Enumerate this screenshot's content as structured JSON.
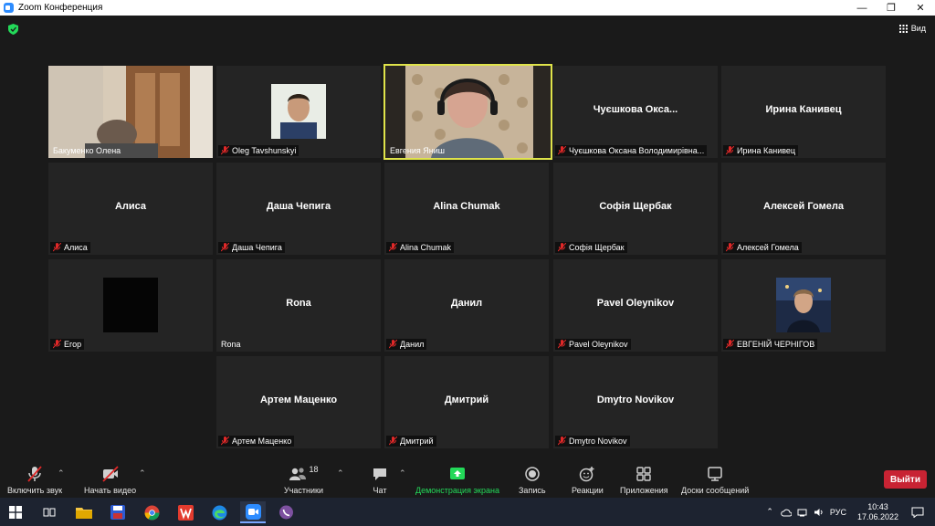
{
  "window": {
    "title": "Zoom Конференция",
    "minimize": "—",
    "maximize": "❐",
    "close": "✕"
  },
  "header": {
    "view_label": "Вид"
  },
  "tiles": [
    {
      "name": "Бакуменко Олена",
      "center": ""
    },
    {
      "name": "Oleg Tavshunskyi",
      "center": ""
    },
    {
      "name": "Евгения Яниш",
      "center": ""
    },
    {
      "name": "Чуєшкова Оксана Володимирівна...",
      "center": "Чуєшкова Окса..."
    },
    {
      "name": "Ирина Канивец",
      "center": "Ирина Канивец"
    },
    {
      "name": "Алиса",
      "center": "Алиса"
    },
    {
      "name": "Даша Чепига",
      "center": "Даша Чепига"
    },
    {
      "name": "Alina Chumak",
      "center": "Alina Chumak"
    },
    {
      "name": "Софія Щербак",
      "center": "Софія Щербак"
    },
    {
      "name": "Алексей Гомела",
      "center": "Алексей Гомела"
    },
    {
      "name": "Егор",
      "center": ""
    },
    {
      "name": "Rona",
      "center": "Rona"
    },
    {
      "name": "Данил",
      "center": "Данил"
    },
    {
      "name": "Pavel Oleynikov",
      "center": "Pavel Oleynikov"
    },
    {
      "name": "ЕВГЕНІЙ ЧЕРНІГОВ",
      "center": ""
    },
    {
      "name": "Артем Маценко",
      "center": "Артем Маценко"
    },
    {
      "name": "Дмитрий",
      "center": "Дмитрий"
    },
    {
      "name": "Dmytro Novikov",
      "center": "Dmytro Novikov"
    }
  ],
  "toolbar": {
    "unmute": "Включить звук",
    "start_video": "Начать видео",
    "participants": "Участники",
    "participants_count": "18",
    "chat": "Чат",
    "share_screen": "Демонстрация экрана",
    "record": "Запись",
    "reactions": "Реакции",
    "apps": "Приложения",
    "whiteboards": "Доски сообщений",
    "leave": "Выйти",
    "share_color": "#23d959",
    "leave_color": "#c82333"
  },
  "taskbar": {
    "lang": "РУС",
    "time": "10:43",
    "date": "17.06.2022"
  }
}
